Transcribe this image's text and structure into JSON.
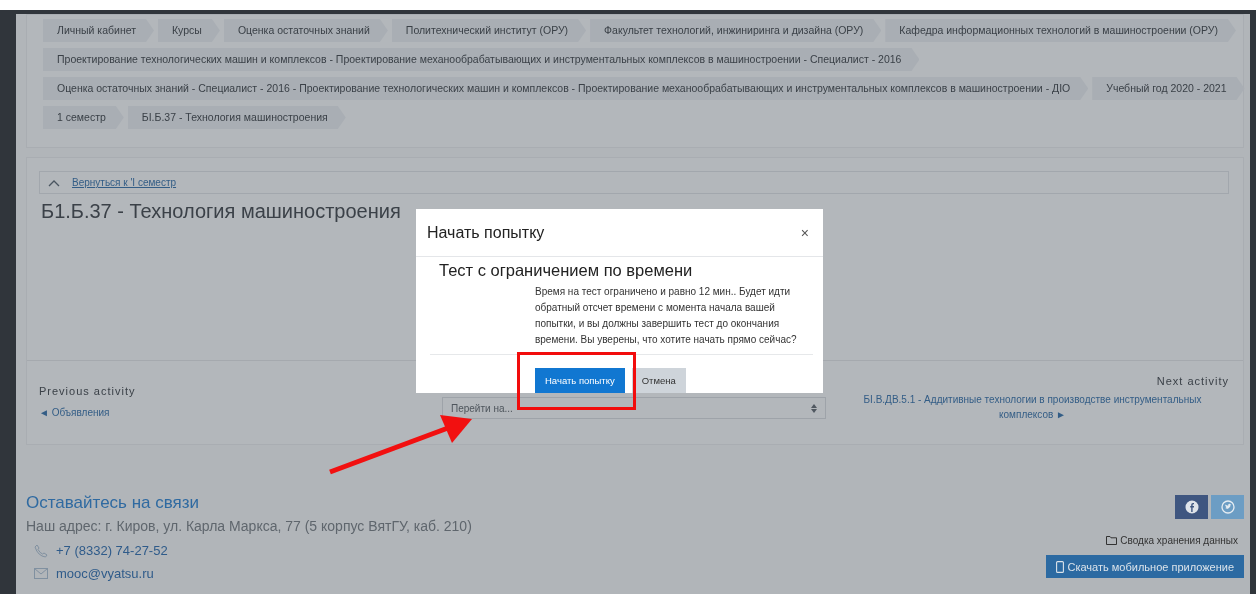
{
  "breadcrumb_rows": [
    [
      "Личный кабинет",
      "Курсы",
      "Оценка остаточных знаний",
      "Политехнический институт (ОРУ)",
      "Факультет технологий, инжиниринга и дизайна (ОРУ)",
      "Кафедра информационных технологий в машиностроении (ОРУ)"
    ],
    [
      "Проектирование технологических машин и комплексов - Проектирование механообрабатывающих и инструментальных комплексов в машиностроении - Специалист - 2016"
    ],
    [
      "Оценка остаточных знаний - Специалист - 2016 - Проектирование технологических машин и комплексов - Проектирование механообрабатывающих и инструментальных комплексов в машиностроении - ДIО",
      "Учебный год 2020 - 2021"
    ],
    [
      "1 семестр",
      "БI.Б.37 - Технология машиностроения"
    ]
  ],
  "back_link": "Вернуться к 'I семестр",
  "page_title": "Б1.Б.37 - Технология машиностроения",
  "navigation": {
    "previous_label": "Previous activity",
    "previous_link": "◄ Объявления",
    "jump_placeholder": "Перейти на...",
    "next_label": "Next activity",
    "next_link": "БI.В.ДВ.5.1 - Аддитивные технологии в производстве инструментальных комплексов ►"
  },
  "footer": {
    "title": "Оставайтесь на связи",
    "address": "Наш адрес: г. Киров, ул. Карла Маркса, 77 (5 корпус ВятГУ, каб. 210)",
    "phone": "+7 (8332) 74-27-52",
    "email": "mooc@vyatsu.ru",
    "data_summary": "Сводка хранения данных",
    "app_button": "Скачать мобильное приложение"
  },
  "modal": {
    "title": "Начать попытку",
    "close": "×",
    "heading": "Тест с ограничением по времени",
    "text": "Время на тест ограничено и равно 12 мин.. Будет идти обратный отсчет времени с момента начала вашей попытки, и вы должны завершить тест до окончания времени. Вы уверены, что хотите начать прямо сейчас?",
    "buttons": [
      {
        "label": "Начать попытку",
        "kind": "primary"
      },
      {
        "label": "Отмена",
        "kind": "secondary"
      }
    ]
  }
}
